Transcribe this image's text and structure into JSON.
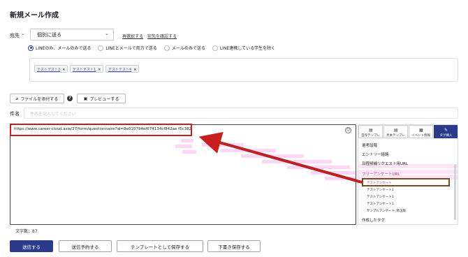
{
  "header": {
    "title": "新規メール作成"
  },
  "destination": {
    "label": "宛先",
    "selected": "個別に送る",
    "reselect_link": "再選択する",
    "confirm_link": "宛先を確認する"
  },
  "send_options": [
    {
      "label": "LINEのみ、メールのみで送る",
      "selected": true
    },
    {
      "label": "LINEとメールで両方で送る",
      "selected": false
    },
    {
      "label": "メールのみで送る",
      "selected": false
    },
    {
      "label": "LINE連携している学生を除く",
      "selected": false
    }
  ],
  "recipients": [
    "テストテスト2",
    "テストテスト1",
    "テストテスト4"
  ],
  "toolbar": {
    "attach_label": "ファイルを添付する",
    "help_label": "?",
    "preview_label": "プレビューする"
  },
  "subject": {
    "label": "件名",
    "placeholder": "件名を記入してください"
  },
  "editor": {
    "url": "https://www.career-cloud.asia/27/form/questionnaire?id=8e010794ef674134cf842ae f5c382",
    "char_count": "文字数：87",
    "emoji_icon": "smile-icon"
  },
  "tag_panel": {
    "tabs": [
      {
        "label": "自作テンプレ",
        "icon": "doc-icon",
        "active": false
      },
      {
        "label": "見本テンプレ",
        "icon": "doc-icon",
        "active": false
      },
      {
        "label": "イベント情報",
        "icon": "calendar-icon",
        "active": false
      },
      {
        "label": "タグ挿入",
        "icon": "tag-icon",
        "active": true
      }
    ],
    "items": [
      {
        "label": "選考段階",
        "type": "section"
      },
      {
        "label": "エントリー経路",
        "type": "section"
      },
      {
        "label": "日程候補リクエスト用URL",
        "type": "section"
      },
      {
        "label": "フリーアンケートURL",
        "type": "section-pink"
      },
      {
        "label": "テストアンケート",
        "type": "sub-pink"
      },
      {
        "label": "テストアンケート1",
        "type": "sub"
      },
      {
        "label": "テストアンケート1",
        "type": "sub"
      },
      {
        "label": "テストアンケート1",
        "type": "sub"
      },
      {
        "label": "サンプルアンケート_修正版",
        "type": "sub"
      },
      {
        "label": "作成したタグ",
        "type": "section"
      }
    ]
  },
  "actions": {
    "send": "送信する",
    "schedule": "送信予約する",
    "save_template": "テンプレートとして保存する",
    "save_draft": "下書き保存する"
  },
  "colors": {
    "primary": "#2b3a8b",
    "highlight_red": "#c81e1e",
    "pink": "#ffd6f5"
  }
}
